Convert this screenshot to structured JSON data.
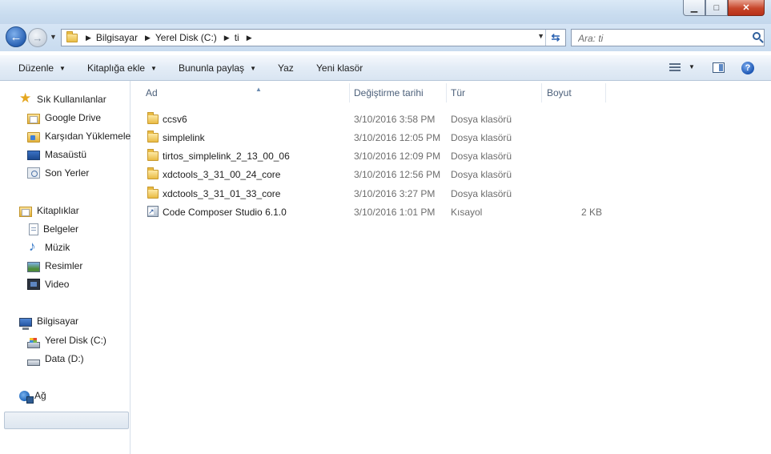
{
  "window": {
    "minimize_glyph": "▁",
    "maximize_glyph": "□",
    "close_glyph": "✕"
  },
  "navigation": {
    "breadcrumbs": [
      "Bilgisayar",
      "Yerel Disk (C:)",
      "ti"
    ],
    "search_placeholder": "Ara: ti"
  },
  "toolbar": {
    "organize": "Düzenle",
    "include_in_library": "Kitaplığa ekle",
    "share_with": "Bununla paylaş",
    "burn": "Yaz",
    "new_folder": "Yeni klasör"
  },
  "sidebar": {
    "favorites": {
      "header": "Sık Kullanılanlar",
      "items": [
        "Google Drive",
        "Karşıdan Yüklemeler",
        "Masaüstü",
        "Son Yerler"
      ]
    },
    "libraries": {
      "header": "Kitaplıklar",
      "items": [
        "Belgeler",
        "Müzik",
        "Resimler",
        "Video"
      ]
    },
    "computer": {
      "header": "Bilgisayar",
      "items": [
        "Yerel Disk (C:)",
        "Data (D:)"
      ],
      "selected": "Yerel Disk (C:)"
    },
    "network": {
      "header": "Ağ"
    }
  },
  "columns": {
    "name": "Ad",
    "date_modified": "Değiştirme tarihi",
    "type": "Tür",
    "size": "Boyut"
  },
  "files": [
    {
      "name": "ccsv6",
      "date": "3/10/2016 3:58 PM",
      "type": "Dosya klasörü",
      "size": "",
      "icon": "folder-icon"
    },
    {
      "name": "simplelink",
      "date": "3/10/2016 12:05 PM",
      "type": "Dosya klasörü",
      "size": "",
      "icon": "folder-icon"
    },
    {
      "name": "tirtos_simplelink_2_13_00_06",
      "date": "3/10/2016 12:09 PM",
      "type": "Dosya klasörü",
      "size": "",
      "icon": "folder-icon"
    },
    {
      "name": "xdctools_3_31_00_24_core",
      "date": "3/10/2016 12:56 PM",
      "type": "Dosya klasörü",
      "size": "",
      "icon": "folder-icon"
    },
    {
      "name": "xdctools_3_31_01_33_core",
      "date": "3/10/2016 3:27 PM",
      "type": "Dosya klasörü",
      "size": "",
      "icon": "folder-icon"
    },
    {
      "name": "Code Composer Studio 6.1.0",
      "date": "3/10/2016 1:01 PM",
      "type": "Kısayol",
      "size": "2 KB",
      "icon": "shortcut-icon"
    }
  ]
}
